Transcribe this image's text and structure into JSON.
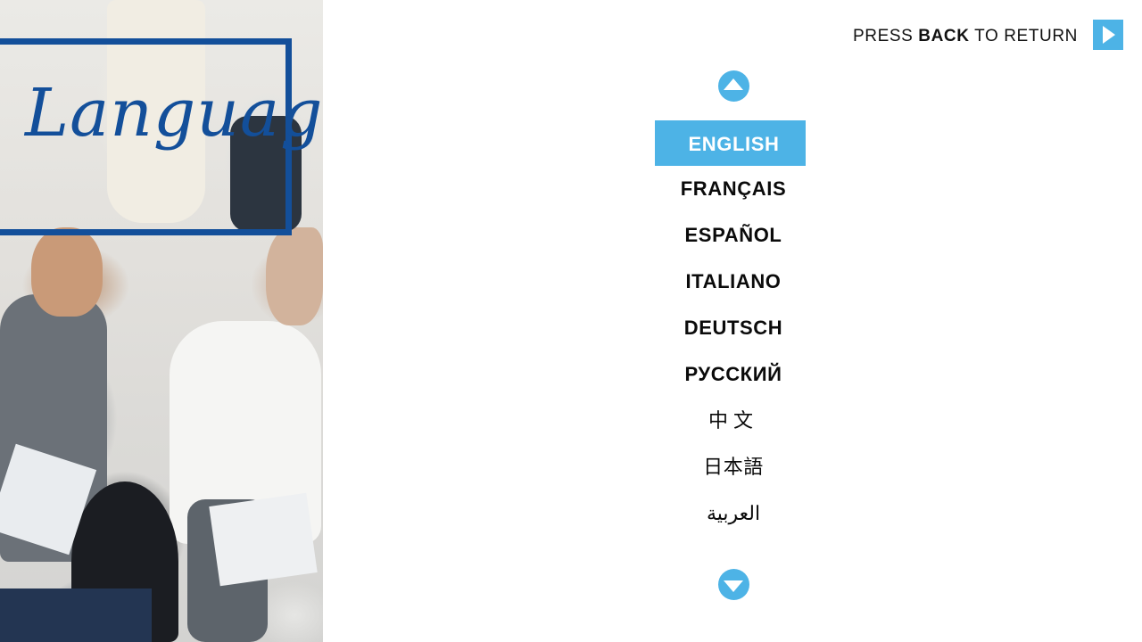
{
  "header": {
    "back_hint": {
      "prefix": "PRESS ",
      "key": "BACK",
      "suffix": " TO RETURN"
    },
    "back_button_icon": "play-triangle-icon"
  },
  "sidebar": {
    "title": "Languages",
    "photo_description_icon": "business-people-photo"
  },
  "language_list": {
    "scroll_up_icon": "chevron-up-icon",
    "scroll_down_icon": "chevron-down-icon",
    "selected_index": 0,
    "items": [
      {
        "label": "ENGLISH"
      },
      {
        "label": "FRANÇAIS"
      },
      {
        "label": "ESPAÑOL"
      },
      {
        "label": "ITALIANO"
      },
      {
        "label": "DEUTSCH"
      },
      {
        "label": "РУССКИЙ"
      },
      {
        "label": "中文"
      },
      {
        "label": "日本語"
      },
      {
        "label": "العربية"
      }
    ]
  },
  "colors": {
    "accent": "#4db3e6",
    "frame_blue": "#134f9a",
    "text": "#0b0b0b",
    "background": "#ffffff"
  }
}
